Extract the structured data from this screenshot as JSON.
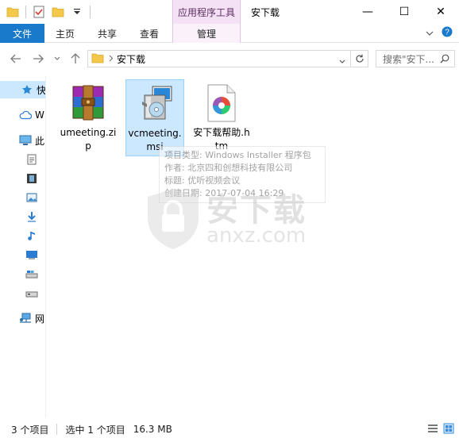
{
  "titlebar": {
    "context_header": "应用程序工具",
    "title": "安下载",
    "minimize_glyph": "—",
    "maximize_glyph": "☐",
    "close_glyph": "✕"
  },
  "ribbon": {
    "file": "文件",
    "home": "主页",
    "share": "共享",
    "view": "查看",
    "manage": "管理"
  },
  "address": {
    "path": "安下载",
    "search_placeholder": "搜索\"安下..."
  },
  "nav": {
    "items": [
      {
        "label": "快",
        "icon": "star-icon"
      },
      {
        "label": "W",
        "icon": "cloud-icon"
      },
      {
        "label": "此",
        "icon": "computer-icon"
      },
      {
        "label": "",
        "icon": "doc-icon"
      },
      {
        "label": "",
        "icon": "film-icon"
      },
      {
        "label": "",
        "icon": "image-icon"
      },
      {
        "label": "",
        "icon": "download-icon"
      },
      {
        "label": "",
        "icon": "music-icon"
      },
      {
        "label": "",
        "icon": "desktop-icon"
      },
      {
        "label": "",
        "icon": "drive-icon"
      },
      {
        "label": "",
        "icon": "drive-icon"
      },
      {
        "label": "网",
        "icon": "network-icon"
      }
    ]
  },
  "files": [
    {
      "name": "umeeting.zip",
      "type": "zip"
    },
    {
      "name": "vcmeeting.msi",
      "type": "msi"
    },
    {
      "name": "安下载帮助.htm",
      "type": "htm"
    }
  ],
  "tooltip": {
    "line1": "项目类型: Windows Installer 程序包",
    "line2": "作者: 北京四和创想科技有限公司",
    "line3": "标题: 优听视频会议",
    "line4": "创建日期: 2017-07-04 16:29"
  },
  "watermark": {
    "text1": "安下载",
    "text2": "anxz.com"
  },
  "status": {
    "count": "3 个项目",
    "selected": "选中 1 个项目",
    "size": "16.3 MB"
  }
}
